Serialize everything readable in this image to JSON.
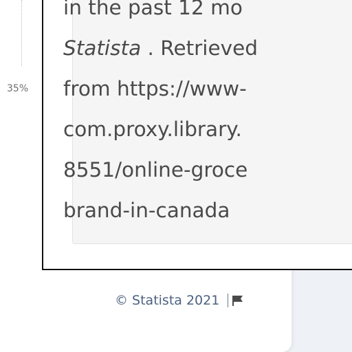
{
  "chart": {
    "tick_label": "35%"
  },
  "citation": {
    "lines": [
      "in the past 12 mo",
      " . Retrieved",
      "from https://www-",
      "com.proxy.library.",
      "8551/online-groce",
      "brand-in-canada"
    ],
    "source_italic": "Statista"
  },
  "footer": {
    "copyright": "© Statista 2021",
    "flag_icon": "flag-icon"
  }
}
